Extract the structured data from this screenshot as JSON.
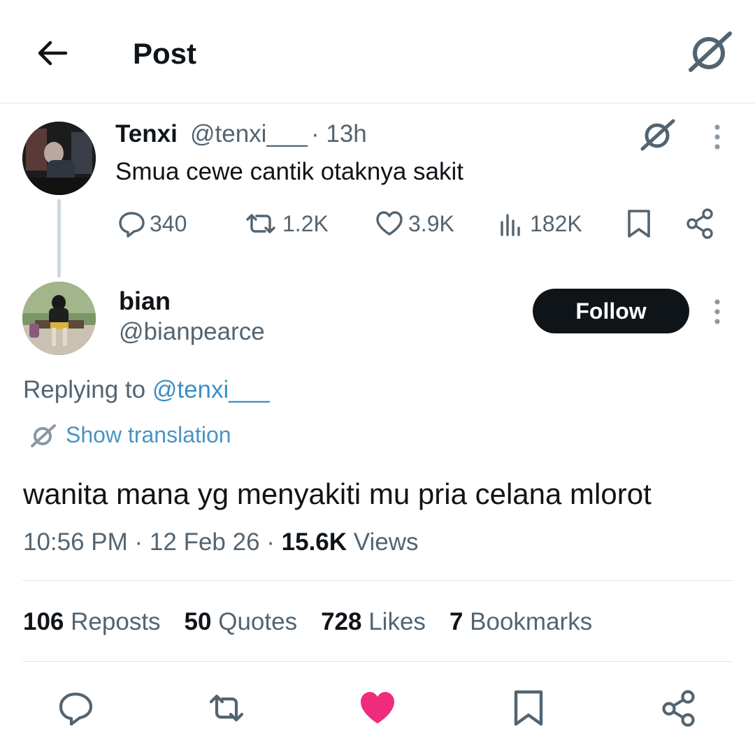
{
  "header": {
    "title": "Post"
  },
  "parent": {
    "name": "Tenxi",
    "handle": "@tenxi___",
    "time": "· 13h",
    "text": "Smua cewe cantik otaknya sakit",
    "replies": "340",
    "reposts": "1.2K",
    "likes": "3.9K",
    "views": "182K"
  },
  "main": {
    "name": "bian",
    "handle": "@bianpearce",
    "follow_label": "Follow",
    "replying_prefix": "Replying to ",
    "replying_handle": "@tenxi___",
    "translate_label": "Show translation",
    "text": "wanita mana yg menyakiti mu pria celana mlorot",
    "time": "10:56 PM",
    "date": "12 Feb 26",
    "views_count": "15.6K",
    "views_label": "Views"
  },
  "stats": [
    {
      "count": "106",
      "label": "Reposts"
    },
    {
      "count": "50",
      "label": "Quotes"
    },
    {
      "count": "728",
      "label": "Likes"
    },
    {
      "count": "7",
      "label": "Bookmarks"
    }
  ],
  "colors": {
    "text": "#0f1419",
    "secondary": "#536471",
    "link": "#3c8fc5",
    "like_active": "#f02b7c",
    "divider": "#e1e6ea"
  },
  "icons": [
    "back-arrow-icon",
    "grok-icon",
    "more-icon",
    "reply-icon",
    "repost-icon",
    "heart-icon",
    "views-icon",
    "bookmark-icon",
    "share-icon"
  ]
}
